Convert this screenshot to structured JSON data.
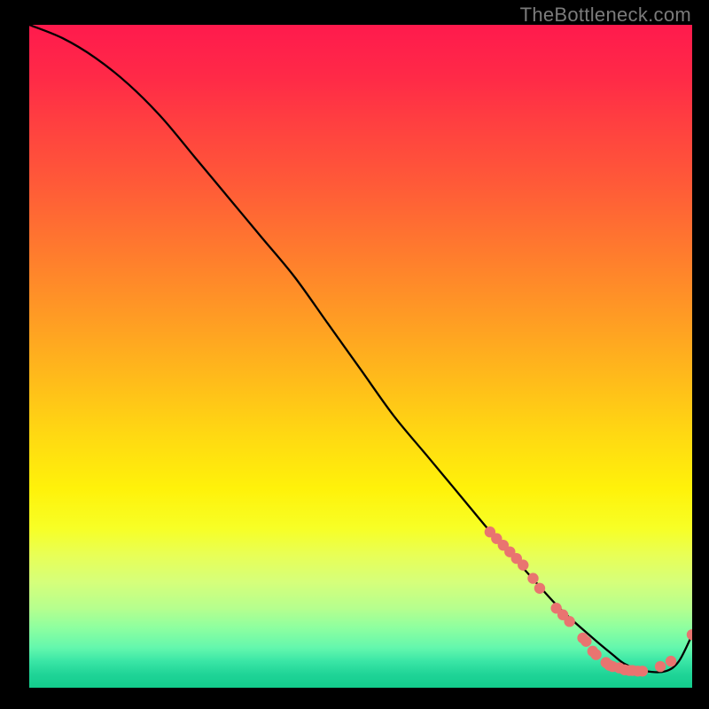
{
  "watermark": "TheBottleneck.com",
  "colors": {
    "curve_stroke": "#000000",
    "dot_fill": "#e97470",
    "background": "#000000"
  },
  "chart_data": {
    "type": "line",
    "title": "",
    "xlabel": "",
    "ylabel": "",
    "xlim": [
      0,
      100
    ],
    "ylim": [
      0,
      100
    ],
    "grid": false,
    "series": [
      {
        "name": "bottleneck-curve",
        "x": [
          0,
          5,
          10,
          15,
          20,
          25,
          30,
          35,
          40,
          45,
          50,
          55,
          60,
          65,
          70,
          75,
          80,
          85,
          88,
          90,
          93,
          96,
          98,
          100
        ],
        "values": [
          100,
          98,
          95,
          91,
          86,
          80,
          74,
          68,
          62,
          55,
          48,
          41,
          35,
          29,
          23,
          17.5,
          12,
          7.5,
          5,
          3.5,
          2.5,
          2.5,
          4,
          8
        ]
      }
    ],
    "markers": [
      {
        "name": "dot",
        "x": 69.5,
        "values": 23.5
      },
      {
        "name": "dot",
        "x": 70.5,
        "values": 22.5
      },
      {
        "name": "dot",
        "x": 71.5,
        "values": 21.5
      },
      {
        "name": "dot",
        "x": 72.5,
        "values": 20.5
      },
      {
        "name": "dot",
        "x": 73.5,
        "values": 19.5
      },
      {
        "name": "dot",
        "x": 74.5,
        "values": 18.5
      },
      {
        "name": "dot",
        "x": 76.0,
        "values": 16.5
      },
      {
        "name": "dot",
        "x": 77.0,
        "values": 15.0
      },
      {
        "name": "dot",
        "x": 79.5,
        "values": 12.0
      },
      {
        "name": "dot",
        "x": 80.5,
        "values": 11.0
      },
      {
        "name": "dot",
        "x": 81.5,
        "values": 10.0
      },
      {
        "name": "dot",
        "x": 83.5,
        "values": 7.5
      },
      {
        "name": "dot",
        "x": 84.0,
        "values": 7.0
      },
      {
        "name": "dot",
        "x": 85.0,
        "values": 5.5
      },
      {
        "name": "dot",
        "x": 85.5,
        "values": 5.0
      },
      {
        "name": "dot",
        "x": 87.0,
        "values": 3.8
      },
      {
        "name": "dot",
        "x": 87.5,
        "values": 3.4
      },
      {
        "name": "dot",
        "x": 88.0,
        "values": 3.2
      },
      {
        "name": "dot",
        "x": 89.0,
        "values": 3.0
      },
      {
        "name": "dot",
        "x": 89.8,
        "values": 2.7
      },
      {
        "name": "dot",
        "x": 90.5,
        "values": 2.6
      },
      {
        "name": "dot",
        "x": 91.0,
        "values": 2.6
      },
      {
        "name": "dot",
        "x": 91.8,
        "values": 2.5
      },
      {
        "name": "dot",
        "x": 92.5,
        "values": 2.5
      },
      {
        "name": "dot",
        "x": 95.2,
        "values": 3.2
      },
      {
        "name": "dot",
        "x": 96.8,
        "values": 4.0
      },
      {
        "name": "dot",
        "x": 100,
        "values": 8.0
      }
    ]
  }
}
